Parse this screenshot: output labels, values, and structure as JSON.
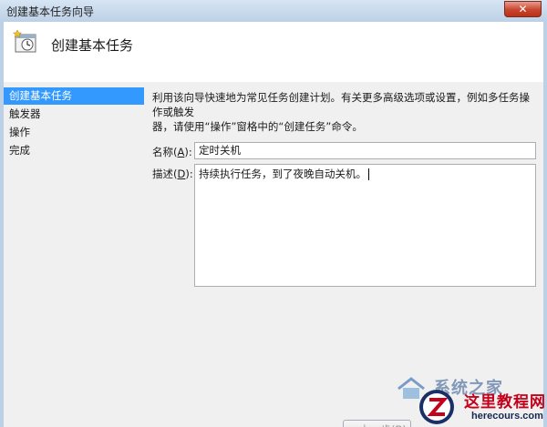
{
  "window": {
    "title": "创建基本任务向导",
    "close_glyph": "✕"
  },
  "header": {
    "title": "创建基本任务",
    "icon": "task-scheduler-icon"
  },
  "steps": [
    {
      "label": "创建基本任务",
      "active": true
    },
    {
      "label": "触发器",
      "active": false
    },
    {
      "label": "操作",
      "active": false
    },
    {
      "label": "完成",
      "active": false
    }
  ],
  "main": {
    "description_line1": "利用该向导快速地为常见任务创建计划。有关更多高级选项或设置，例如多任务操作或触发",
    "description_line2": "器，请使用“操作”窗格中的“创建任务”命令。",
    "name_label": "名称(",
    "name_label_key": "A",
    "name_label_end": "):",
    "name_value": "定时关机",
    "desc_label": "描述(",
    "desc_label_key": "D",
    "desc_label_end": "):",
    "desc_value": "持续执行任务，到了夜晚自动关机。"
  },
  "buttons": {
    "back": "< 上一步(B)"
  },
  "watermark": {
    "text1": "系统之家",
    "site_name": "这里教程网",
    "site_url": "herecours.com"
  },
  "colors": {
    "selection": "#3399ff",
    "titlebar": "#bcd0e6",
    "close": "#c8452e",
    "watermark_red": "#c4001a"
  }
}
